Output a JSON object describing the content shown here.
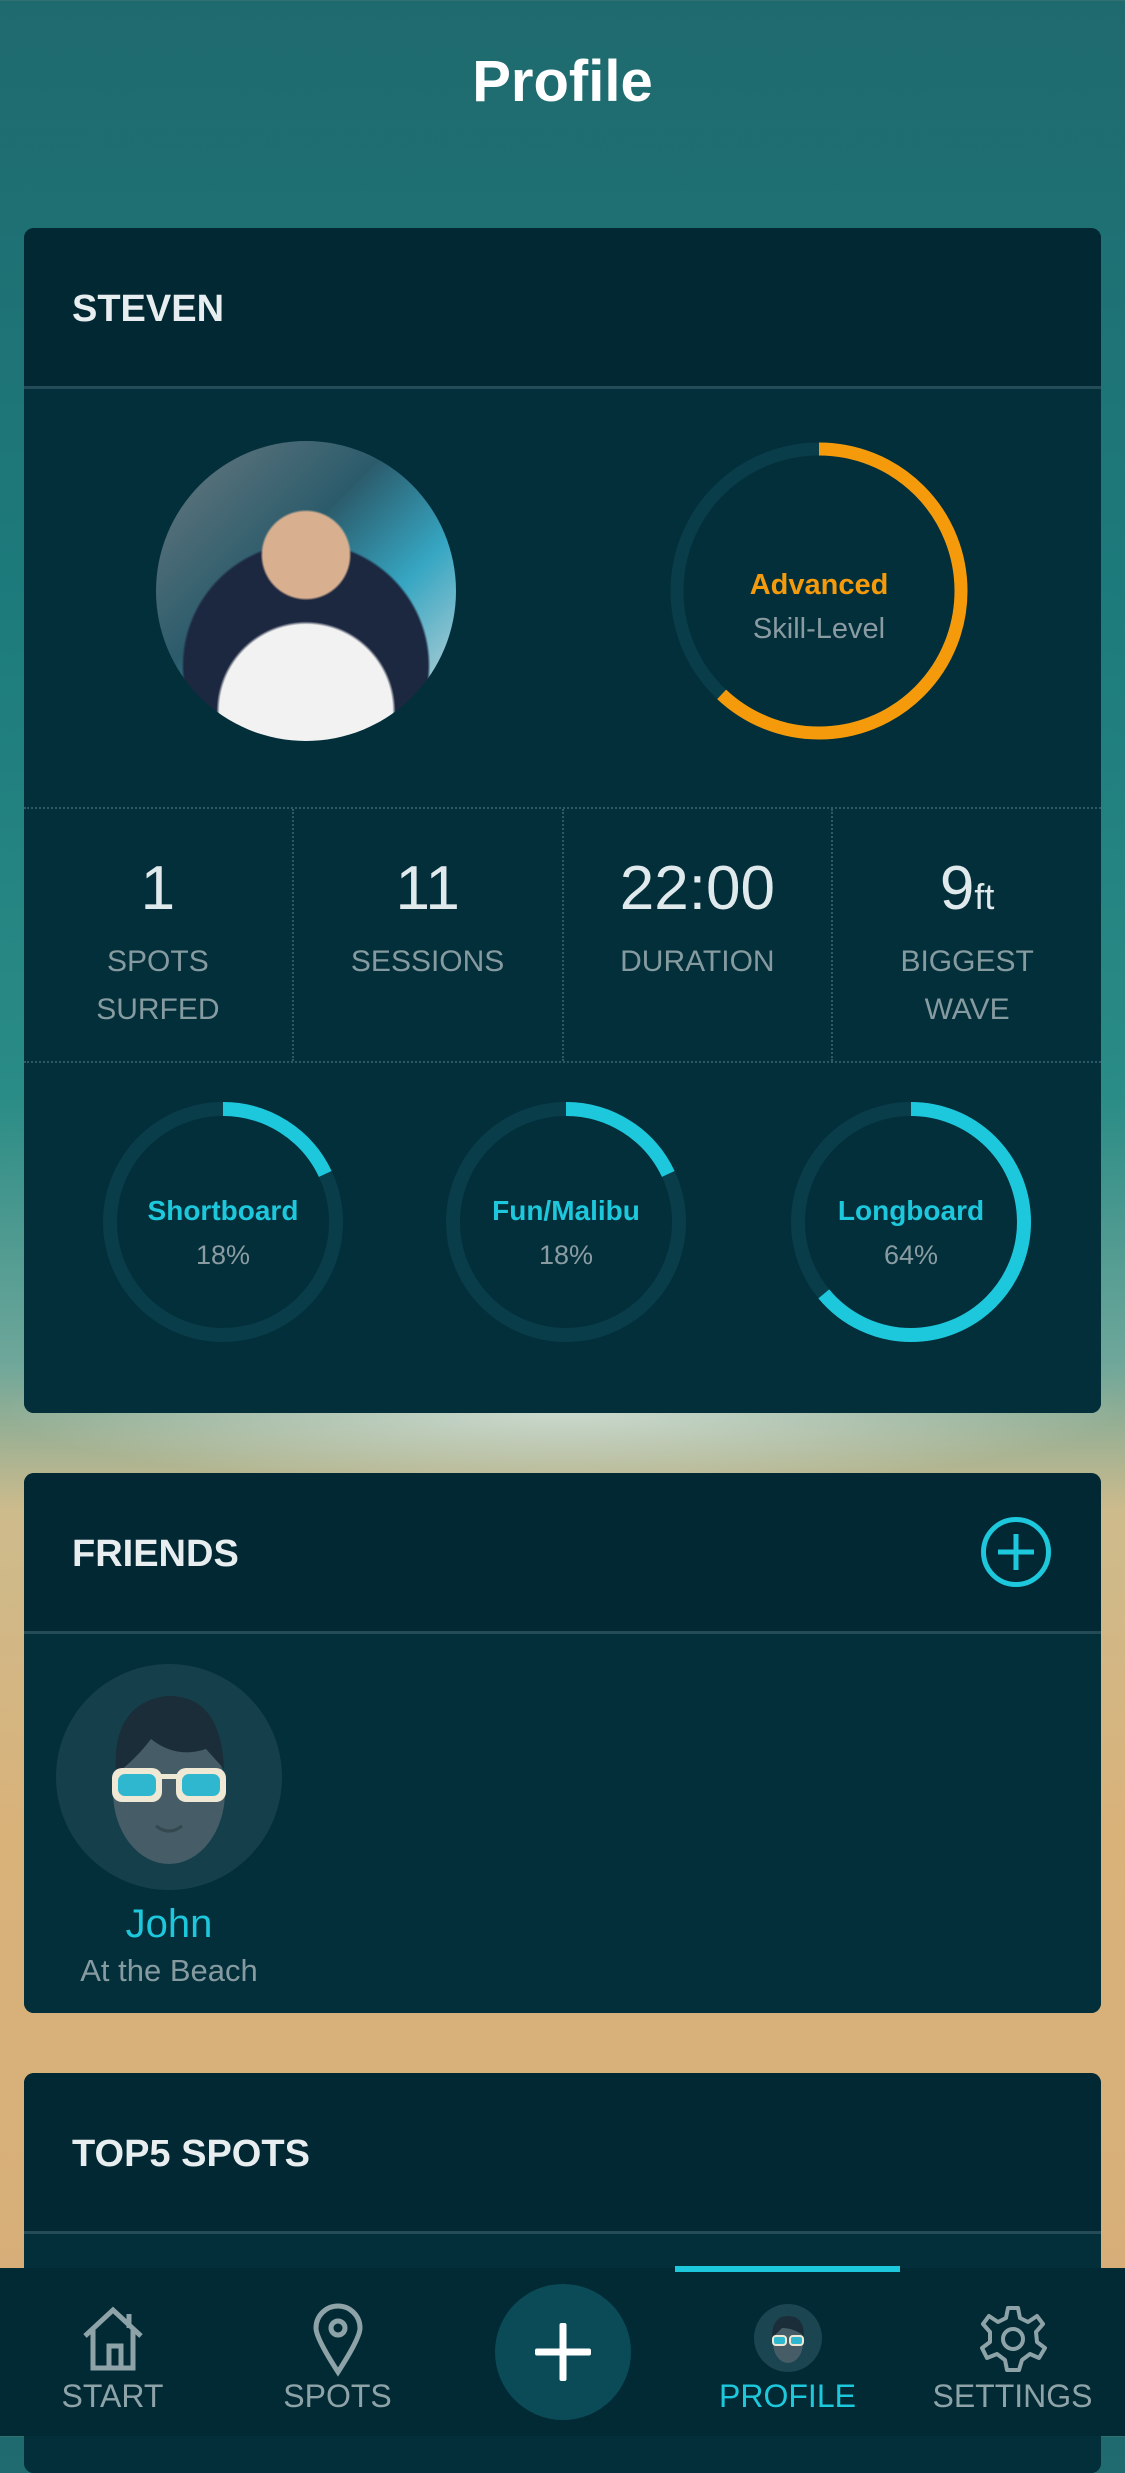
{
  "header": {
    "title": "Profile"
  },
  "profile": {
    "name": "STEVEN",
    "skill": {
      "level": "Advanced",
      "label": "Skill-Level",
      "progress": 0.62,
      "color": "#f59b0b"
    },
    "stats": [
      {
        "value": "1",
        "unit": "",
        "label_line1": "SPOTS",
        "label_line2": "SURFED"
      },
      {
        "value": "11",
        "unit": "",
        "label_line1": "SESSIONS",
        "label_line2": ""
      },
      {
        "value": "22:00",
        "unit": "",
        "label_line1": "DURATION",
        "label_line2": ""
      },
      {
        "value": "9",
        "unit": "ft",
        "label_line1": "BIGGEST",
        "label_line2": "WAVE"
      }
    ],
    "boards": [
      {
        "name": "Shortboard",
        "percent_label": "18%",
        "percent": 18
      },
      {
        "name": "Fun/Malibu",
        "percent_label": "18%",
        "percent": 18
      },
      {
        "name": "Longboard",
        "percent_label": "64%",
        "percent": 64
      }
    ]
  },
  "friends": {
    "title": "FRIENDS",
    "add_icon": "add-circle-icon",
    "list": [
      {
        "name": "John",
        "status": "At the Beach"
      }
    ]
  },
  "top5": {
    "title": "TOP5 SPOTS"
  },
  "nav": {
    "items": [
      {
        "label": "START",
        "icon": "home-icon"
      },
      {
        "label": "SPOTS",
        "icon": "map-pin-icon"
      },
      {
        "label": "",
        "icon": "plus-icon"
      },
      {
        "label": "PROFILE",
        "icon": "avatar-icon",
        "active": true
      },
      {
        "label": "SETTINGS",
        "icon": "gear-icon"
      }
    ]
  },
  "colors": {
    "accent": "#1ec8dc",
    "skill": "#f59b0b",
    "card": "#022a35",
    "track": "#083d49"
  }
}
